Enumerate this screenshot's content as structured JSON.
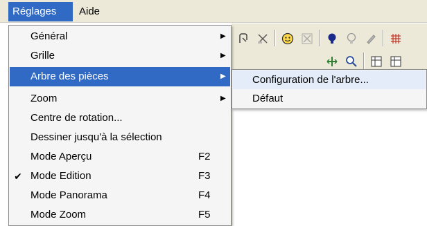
{
  "menubar": {
    "items": [
      {
        "label": "Réglages"
      },
      {
        "label": "Aide"
      }
    ]
  },
  "main_menu": {
    "items": [
      {
        "label": "Général",
        "submenu": true
      },
      {
        "label": "Grille",
        "submenu": true
      },
      {
        "label": "Arbre des pièces",
        "submenu": true,
        "highlighted": true
      },
      {
        "label": "Zoom",
        "submenu": true
      },
      {
        "label": "Centre de rotation..."
      },
      {
        "label": "Dessiner jusqu'à la sélection"
      },
      {
        "label": "Mode Aperçu",
        "shortcut": "F2"
      },
      {
        "label": "Mode Edition",
        "shortcut": "F3",
        "checked": true
      },
      {
        "label": "Mode Panorama",
        "shortcut": "F4"
      },
      {
        "label": "Mode Zoom",
        "shortcut": "F5"
      }
    ]
  },
  "sub_menu": {
    "items": [
      {
        "label": "Configuration de l'arbre..."
      },
      {
        "label": "Défaut"
      }
    ]
  },
  "glyphs": {
    "check": "✔",
    "arrow": "▶"
  },
  "colors": {
    "highlight": "#316ac5",
    "menu_bg": "#f5f5f5",
    "toolbar_bg": "#ece9d8"
  }
}
